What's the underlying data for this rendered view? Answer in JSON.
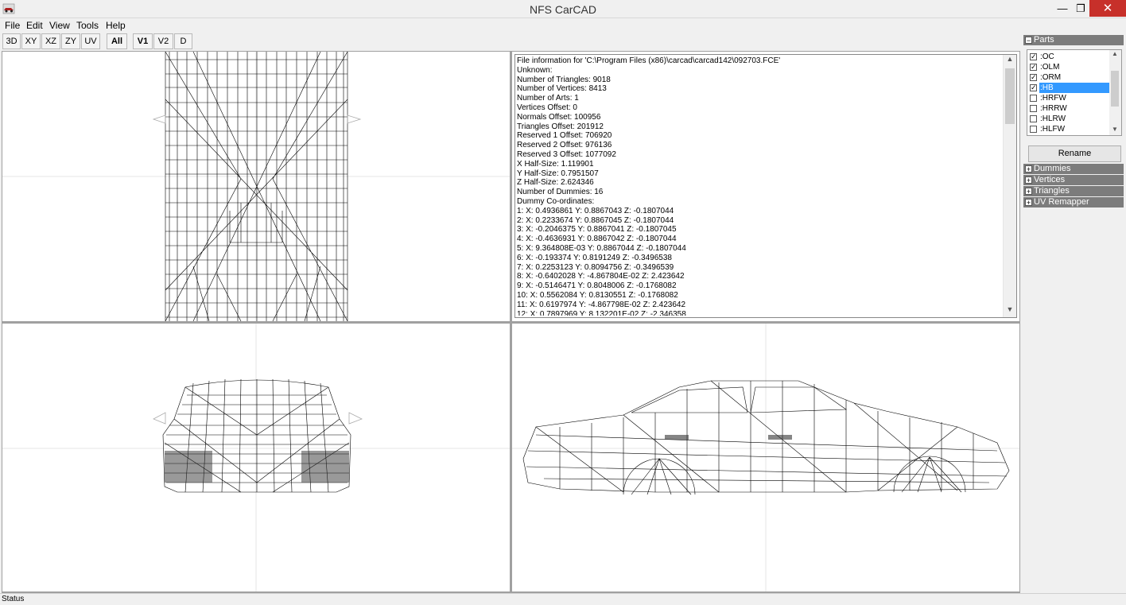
{
  "window": {
    "title": "NFS CarCAD",
    "minimize_glyph": "—",
    "maximize_glyph": "❐",
    "close_glyph": "✕"
  },
  "menu": [
    {
      "label": "File"
    },
    {
      "label": "Edit"
    },
    {
      "label": "View"
    },
    {
      "label": "Tools"
    },
    {
      "label": "Help"
    }
  ],
  "toolbar": {
    "buttons": [
      {
        "label": "3D"
      },
      {
        "label": "XY"
      },
      {
        "label": "XZ"
      },
      {
        "label": "ZY"
      },
      {
        "label": "UV"
      },
      {
        "label": "All"
      },
      {
        "label": "V1"
      },
      {
        "label": "V2"
      },
      {
        "label": "D"
      }
    ]
  },
  "info": {
    "lines": [
      "File information for 'C:\\Program Files (x86)\\carcad\\carcad142\\092703.FCE'",
      "Unknown:",
      "Number of Triangles: 9018",
      "Number of Vertices: 8413",
      "Number of Arts: 1",
      "Vertices Offset: 0",
      "Normals Offset: 100956",
      "Triangles Offset: 201912",
      "Reserved 1 Offset: 706920",
      "Reserved 2 Offset: 976136",
      "Reserved 3 Offset: 1077092",
      "X Half-Size: 1.119901",
      "Y Half-Size: 0.7951507",
      "Z Half-Size: 2.624346",
      "Number of Dummies: 16",
      "Dummy Co-ordinates:",
      "1: X: 0.4936861 Y: 0.8867043 Z: -0.1807044",
      "2: X: 0.2233674 Y: 0.8867045 Z: -0.1807044",
      "3: X: -0.2046375 Y: 0.8867041 Z: -0.1807045",
      "4: X: -0.4636931 Y: 0.8867042 Z: -0.1807044",
      "5: X: 9.364808E-03 Y: 0.8867044 Z: -0.1807044",
      "6: X: -0.193374 Y: 0.8191249 Z: -0.3496538",
      "7: X: 0.2253123 Y: 0.8094756 Z: -0.3496539",
      "8: X: -0.6402028 Y: -4.867804E-02 Z: 2.423642",
      "9: X: -0.5146471 Y: 0.8048006 Z: -0.1768082",
      "10: X: 0.5562084 Y: 0.8130551 Z: -0.1768082",
      "11: X: 0.6197974 Y: -4.867798E-02 Z: 2.423642",
      "12: X: 0.7897969 Y: 8.132201E-02 Z: -2.346358"
    ]
  },
  "panel": {
    "parts_header": "Parts",
    "parts": [
      {
        "name": ":OC",
        "checked": true,
        "selected": false
      },
      {
        "name": ":OLM",
        "checked": true,
        "selected": false
      },
      {
        "name": ":ORM",
        "checked": true,
        "selected": false
      },
      {
        "name": ":HB",
        "checked": true,
        "selected": true
      },
      {
        "name": ":HRFW",
        "checked": false,
        "selected": false
      },
      {
        "name": ":HRRW",
        "checked": false,
        "selected": false
      },
      {
        "name": ":HLRW",
        "checked": false,
        "selected": false
      },
      {
        "name": ":HLFW",
        "checked": false,
        "selected": false
      }
    ],
    "rename_label": "Rename",
    "sections": [
      {
        "label": "Dummies"
      },
      {
        "label": "Vertices"
      },
      {
        "label": "Triangles"
      },
      {
        "label": "UV Remapper"
      }
    ]
  },
  "status": {
    "text": "Status"
  },
  "colors": {
    "selection": "#3399ff",
    "close_button": "#c7302a",
    "panel_header": "#7c7c7c"
  }
}
